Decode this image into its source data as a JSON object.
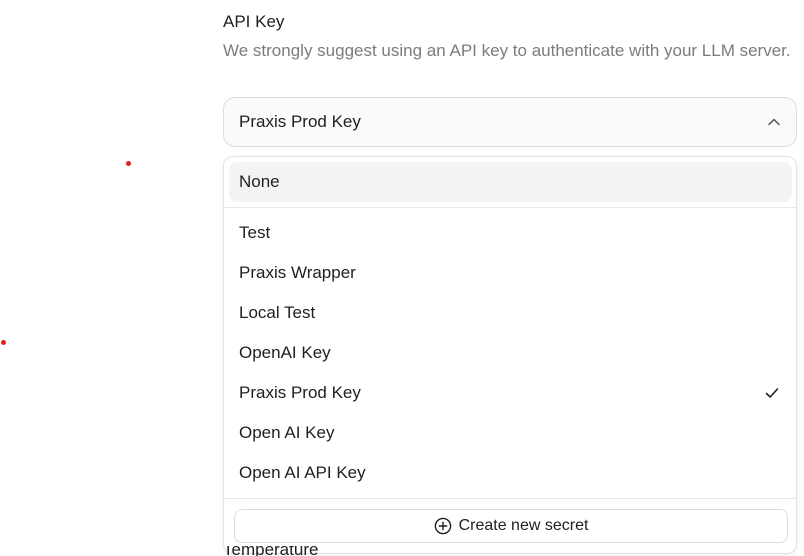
{
  "field": {
    "label": "API Key",
    "help": "We strongly suggest using an API key to authenticate with your LLM server.",
    "selected_value": "Praxis Prod Key"
  },
  "dropdown": {
    "none_option": "None",
    "options": [
      {
        "label": "Test",
        "selected": false
      },
      {
        "label": "Praxis Wrapper",
        "selected": false
      },
      {
        "label": "Local Test",
        "selected": false
      },
      {
        "label": "OpenAI Key",
        "selected": false
      },
      {
        "label": "Praxis Prod Key",
        "selected": true
      },
      {
        "label": "Open AI Key",
        "selected": false
      },
      {
        "label": "Open AI API Key",
        "selected": false
      }
    ],
    "create_label": "Create new secret"
  },
  "below_text": "Temperature",
  "icons": {
    "chevron": "chevron-up-icon",
    "check": "check-icon",
    "create": "plus-circle-icon"
  },
  "colors": {
    "help_text": "#7b7b80",
    "marker_dot": "#e0201a",
    "highlight": "#f3f3f3"
  }
}
